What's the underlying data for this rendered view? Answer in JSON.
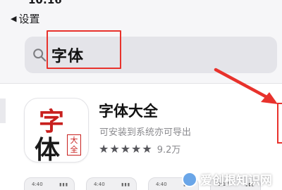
{
  "status": {
    "time": "10:16"
  },
  "nav": {
    "back_label": "设置"
  },
  "search": {
    "query": "字体"
  },
  "result": {
    "app_name": "字体大全",
    "subtitle": "可安装到系统亦可导出",
    "stars": "★★★★★",
    "rating_value": 5,
    "rating_count": "9.2万",
    "icon_chars": {
      "top": "字",
      "bottom": "体",
      "seal": "大全"
    }
  },
  "thumbs": [
    {
      "time": "4:40"
    },
    {
      "time": "4:40"
    },
    {
      "time": "4:40"
    },
    {
      "time": "5:17"
    }
  ],
  "watermark": {
    "text": "爱创根知识网"
  },
  "colors": {
    "annotation": "#e8322c",
    "accent_red": "#c8201e"
  }
}
